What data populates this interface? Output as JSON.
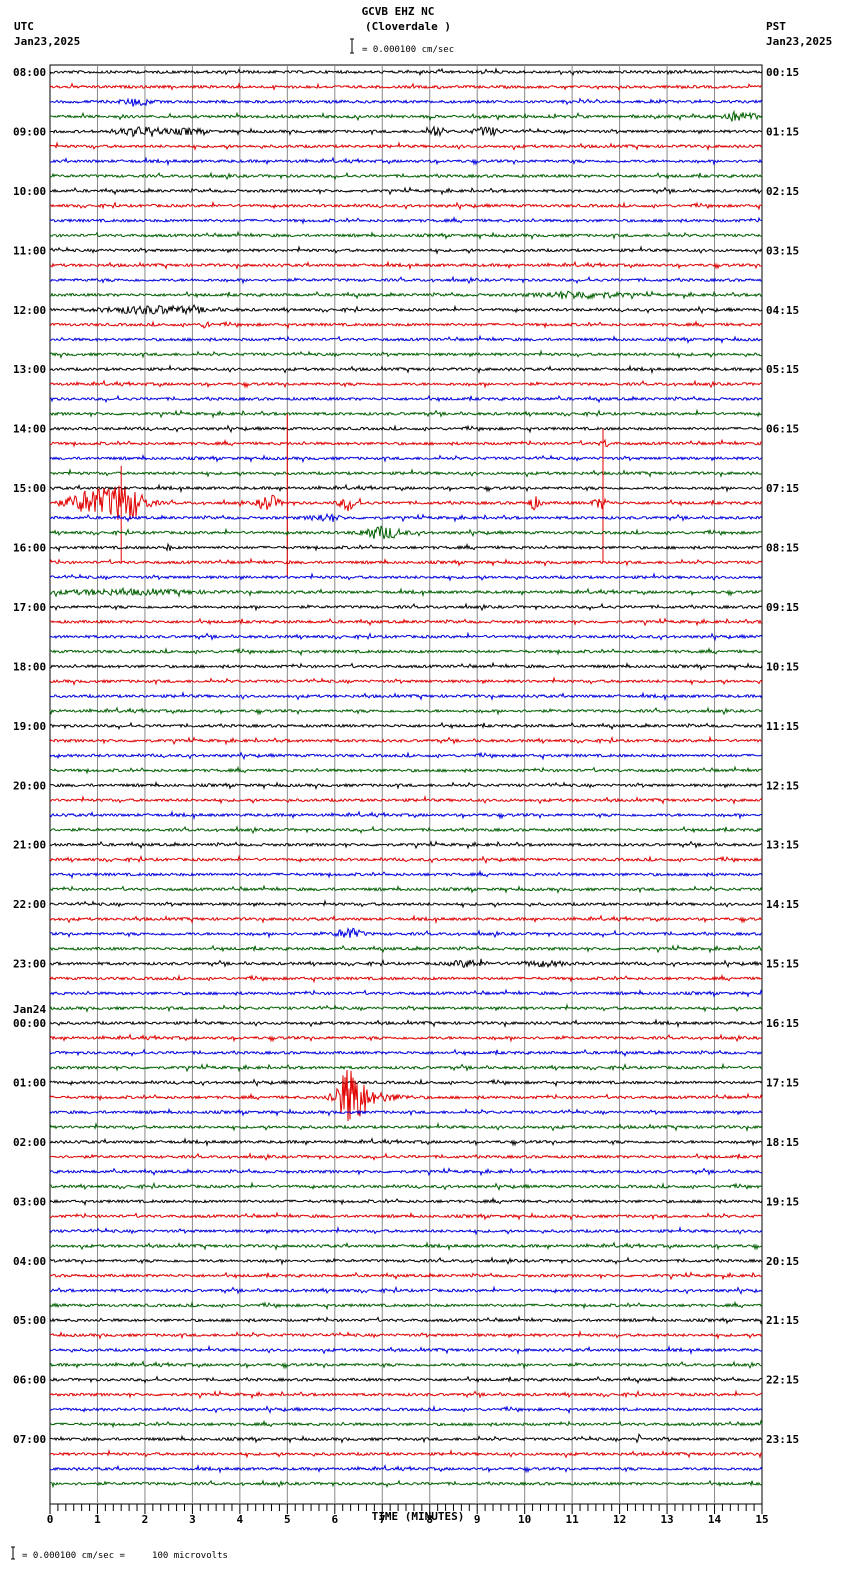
{
  "header": {
    "station": "GCVB EHZ NC",
    "location": "(Cloverdale )",
    "left_tz": "UTC",
    "left_date": "Jan23,2025",
    "right_tz": "PST",
    "right_date": "Jan23,2025",
    "scale": "= 0.000100 cm/sec"
  },
  "footer": {
    "scale": "= 0.000100 cm/sec =     100 microvolts"
  },
  "chart_data": {
    "type": "seismogram",
    "title": "GCVB EHZ NC (Cloverdale )",
    "xlabel": "TIME (MINUTES)",
    "xlim": [
      0,
      15
    ],
    "x_ticks": [
      "0",
      "1",
      "2",
      "3",
      "4",
      "5",
      "6",
      "7",
      "8",
      "9",
      "10",
      "11",
      "12",
      "13",
      "14",
      "15"
    ],
    "minutes_per_trace": 15,
    "traces_per_hour": 4,
    "trace_colors": [
      "#000000",
      "#e00000",
      "#0000e0",
      "#006000"
    ],
    "left_labels": [
      "08:00",
      "09:00",
      "10:00",
      "11:00",
      "12:00",
      "13:00",
      "14:00",
      "15:00",
      "16:00",
      "17:00",
      "18:00",
      "19:00",
      "20:00",
      "21:00",
      "22:00",
      "23:00",
      "00:00",
      "01:00",
      "02:00",
      "03:00",
      "04:00",
      "05:00",
      "06:00",
      "07:00"
    ],
    "date_change_label": "Jan24",
    "right_labels": [
      "00:15",
      "01:15",
      "02:15",
      "03:15",
      "04:15",
      "05:15",
      "06:15",
      "07:15",
      "08:15",
      "09:15",
      "10:15",
      "11:15",
      "12:15",
      "13:15",
      "14:15",
      "15:15",
      "16:15",
      "17:15",
      "18:15",
      "19:15",
      "20:15",
      "21:15",
      "22:15",
      "23:15"
    ],
    "events": [
      {
        "trace": 2,
        "minute": 1.8,
        "amp": 2.5,
        "dur": 0.3
      },
      {
        "trace": 3,
        "minute": 14.5,
        "amp": 4,
        "dur": 0.4
      },
      {
        "trace": 4,
        "minute": 1.9,
        "amp": 4,
        "dur": 0.5
      },
      {
        "trace": 4,
        "minute": 2.9,
        "amp": 2.5,
        "dur": 0.3
      },
      {
        "trace": 4,
        "minute": 8.1,
        "amp": 5,
        "dur": 0.15
      },
      {
        "trace": 4,
        "minute": 9.2,
        "amp": 4,
        "dur": 0.25
      },
      {
        "trace": 15,
        "minute": 11.2,
        "amp": 3,
        "dur": 0.8
      },
      {
        "trace": 16,
        "minute": 2.2,
        "amp": 3.5,
        "dur": 1.0
      },
      {
        "trace": 17,
        "minute": 3.3,
        "amp": 3,
        "dur": 0.1
      },
      {
        "trace": 25,
        "minute": 11.7,
        "amp": 3,
        "dur": 0.1
      },
      {
        "trace": 29,
        "minute": 0.9,
        "amp": 12,
        "dur": 0.5
      },
      {
        "trace": 29,
        "minute": 1.6,
        "amp": 16,
        "dur": 0.4
      },
      {
        "trace": 29,
        "minute": 4.6,
        "amp": 8,
        "dur": 0.2
      },
      {
        "trace": 29,
        "minute": 6.3,
        "amp": 6,
        "dur": 0.2
      },
      {
        "trace": 29,
        "minute": 10.2,
        "amp": 6,
        "dur": 0.12
      },
      {
        "trace": 29,
        "minute": 11.6,
        "amp": 5,
        "dur": 0.15
      },
      {
        "trace": 30,
        "minute": 5.8,
        "amp": 3,
        "dur": 0.3
      },
      {
        "trace": 31,
        "minute": 7.0,
        "amp": 6,
        "dur": 0.4
      },
      {
        "trace": 32,
        "minute": 2.5,
        "amp": 3,
        "dur": 0.05
      },
      {
        "trace": 35,
        "minute": 1.5,
        "amp": 2,
        "dur": 1.5
      },
      {
        "trace": 58,
        "minute": 6.3,
        "amp": 5,
        "dur": 0.25
      },
      {
        "trace": 60,
        "minute": 8.8,
        "amp": 3,
        "dur": 0.35
      },
      {
        "trace": 60,
        "minute": 10.4,
        "amp": 2,
        "dur": 0.5
      },
      {
        "trace": 69,
        "minute": 6.35,
        "amp": 30,
        "dur": 0.3
      },
      {
        "trace": 69,
        "minute": 7.0,
        "amp": 3,
        "dur": 0.5
      },
      {
        "trace": 92,
        "minute": 12.4,
        "amp": 4,
        "dur": 0.05
      }
    ],
    "spikes": [
      {
        "trace": 29,
        "minute": 5.0,
        "up": 6,
        "down": 5
      },
      {
        "trace": 29,
        "minute": 11.65,
        "up": 5,
        "down": 4
      },
      {
        "trace": 29,
        "minute": 1.5,
        "up": 2.5,
        "down": 4
      }
    ]
  }
}
